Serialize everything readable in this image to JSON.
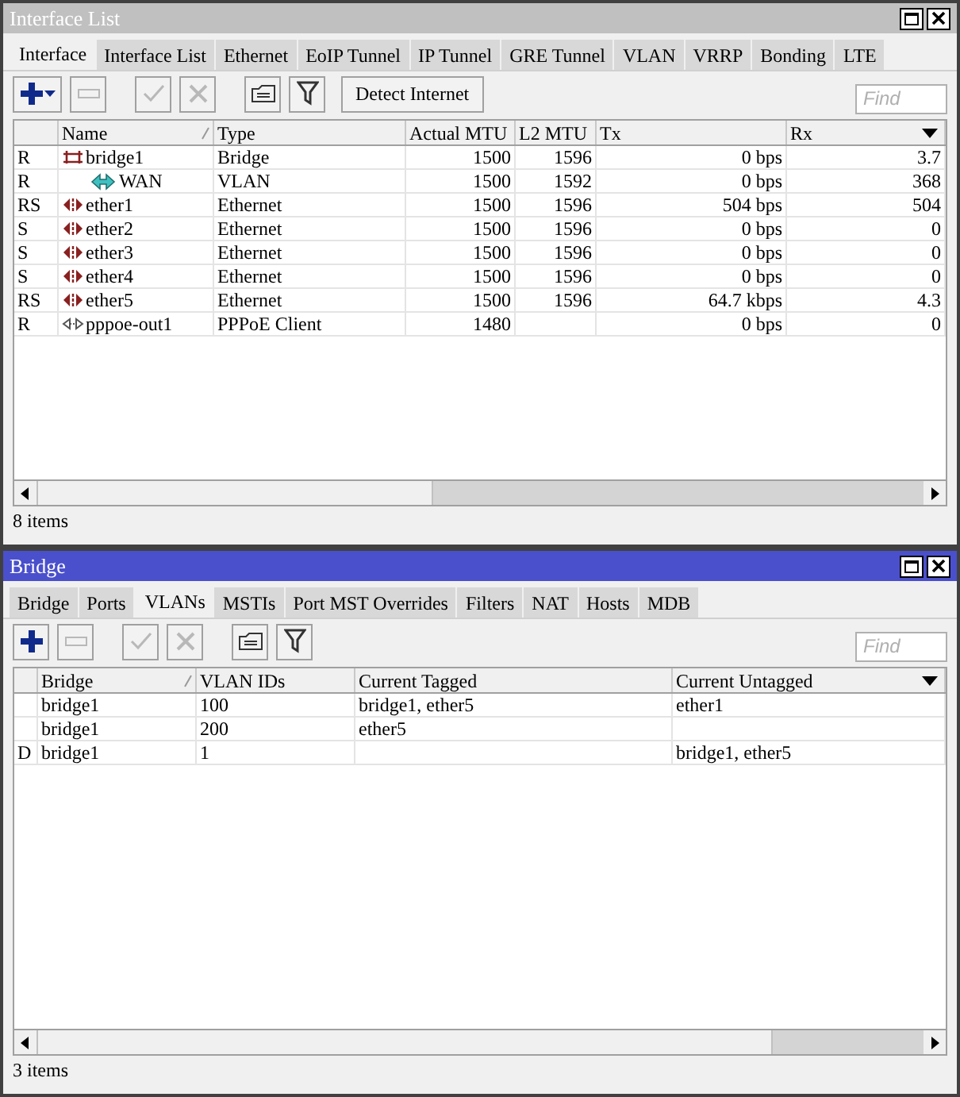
{
  "windows": [
    {
      "title": "Interface List",
      "active": false,
      "tabs": [
        {
          "label": "Interface",
          "selected": true
        },
        {
          "label": "Interface List",
          "selected": false
        },
        {
          "label": "Ethernet",
          "selected": false
        },
        {
          "label": "EoIP Tunnel",
          "selected": false
        },
        {
          "label": "IP Tunnel",
          "selected": false
        },
        {
          "label": "GRE Tunnel",
          "selected": false
        },
        {
          "label": "VLAN",
          "selected": false
        },
        {
          "label": "VRRP",
          "selected": false
        },
        {
          "label": "Bonding",
          "selected": false
        },
        {
          "label": "LTE",
          "selected": false
        }
      ],
      "toolbar": [
        {
          "kind": "add",
          "disabled": false,
          "dropdown": true
        },
        {
          "kind": "remove",
          "disabled": true
        },
        {
          "kind": "enable",
          "disabled": true
        },
        {
          "kind": "disable",
          "disabled": true
        },
        {
          "kind": "comment",
          "disabled": false
        },
        {
          "kind": "filter",
          "disabled": false
        },
        {
          "kind": "text",
          "label": "Detect Internet",
          "disabled": false
        }
      ],
      "find": {
        "placeholder": "Find"
      },
      "columns": [
        {
          "sorted": false
        },
        {
          "label": "Name",
          "sorted": true
        },
        {
          "label": "Type",
          "sorted": false
        },
        {
          "label": "Actual MTU",
          "sorted": false
        },
        {
          "label": "L2 MTU",
          "sorted": false
        },
        {
          "label": "Tx",
          "sorted": false
        },
        {
          "label": "Rx",
          "sorted": false
        }
      ],
      "rows": [
        {
          "kind": "bridge",
          "cells": [
            "R",
            "bridge1",
            "Bridge",
            "1500",
            "1596",
            "0 bps",
            "3.7"
          ],
          "children": [
            {
              "kind": "vlan",
              "cells": [
                "R",
                "WAN",
                "VLAN",
                "1500",
                "1592",
                "0 bps",
                "368"
              ]
            }
          ]
        },
        {
          "kind": "ethernet",
          "cells": [
            "RS",
            "ether1",
            "Ethernet",
            "1500",
            "1596",
            "504 bps",
            "504"
          ]
        },
        {
          "kind": "ethernet",
          "cells": [
            "S",
            "ether2",
            "Ethernet",
            "1500",
            "1596",
            "0 bps",
            "0"
          ]
        },
        {
          "kind": "ethernet",
          "cells": [
            "S",
            "ether3",
            "Ethernet",
            "1500",
            "1596",
            "0 bps",
            "0"
          ]
        },
        {
          "kind": "ethernet",
          "cells": [
            "S",
            "ether4",
            "Ethernet",
            "1500",
            "1596",
            "0 bps",
            "0"
          ]
        },
        {
          "kind": "ethernet",
          "cells": [
            "RS",
            "ether5",
            "Ethernet",
            "1500",
            "1596",
            "64.7 kbps",
            "4.3"
          ]
        },
        {
          "kind": "pppoe",
          "cells": [
            "R",
            "pppoe-out1",
            "PPPoE Client",
            "1480",
            "",
            "0 bps",
            "0"
          ]
        }
      ],
      "status": "8 items"
    },
    {
      "title": "Bridge",
      "active": true,
      "tabs": [
        {
          "label": "Bridge",
          "selected": false
        },
        {
          "label": "Ports",
          "selected": false
        },
        {
          "label": "VLANs",
          "selected": true
        },
        {
          "label": "MSTIs",
          "selected": false
        },
        {
          "label": "Port MST Overrides",
          "selected": false
        },
        {
          "label": "Filters",
          "selected": false
        },
        {
          "label": "NAT",
          "selected": false
        },
        {
          "label": "Hosts",
          "selected": false
        },
        {
          "label": "MDB",
          "selected": false
        }
      ],
      "toolbar": [
        {
          "kind": "add",
          "disabled": false,
          "dropdown": false
        },
        {
          "kind": "remove",
          "disabled": true
        },
        {
          "kind": "enable",
          "disabled": true
        },
        {
          "kind": "disable",
          "disabled": true
        },
        {
          "kind": "comment",
          "disabled": false
        },
        {
          "kind": "filter",
          "disabled": false
        }
      ],
      "find": {
        "placeholder": "Find"
      },
      "columns": [
        {
          "sorted": false
        },
        {
          "label": "Bridge",
          "sorted": true
        },
        {
          "label": "VLAN IDs",
          "sorted": false
        },
        {
          "label": "Current Tagged",
          "sorted": false
        },
        {
          "label": "Current Untagged",
          "sorted": false
        }
      ],
      "rows": [
        {
          "kind": "plain",
          "cells": [
            "",
            "bridge1",
            "100",
            "bridge1, ether5",
            "ether1"
          ]
        },
        {
          "kind": "plain",
          "cells": [
            "",
            "bridge1",
            "200",
            "ether5",
            ""
          ]
        },
        {
          "kind": "plain",
          "cells": [
            "D",
            "bridge1",
            "1",
            "",
            "bridge1, ether5"
          ]
        }
      ],
      "status": "3 items"
    }
  ]
}
